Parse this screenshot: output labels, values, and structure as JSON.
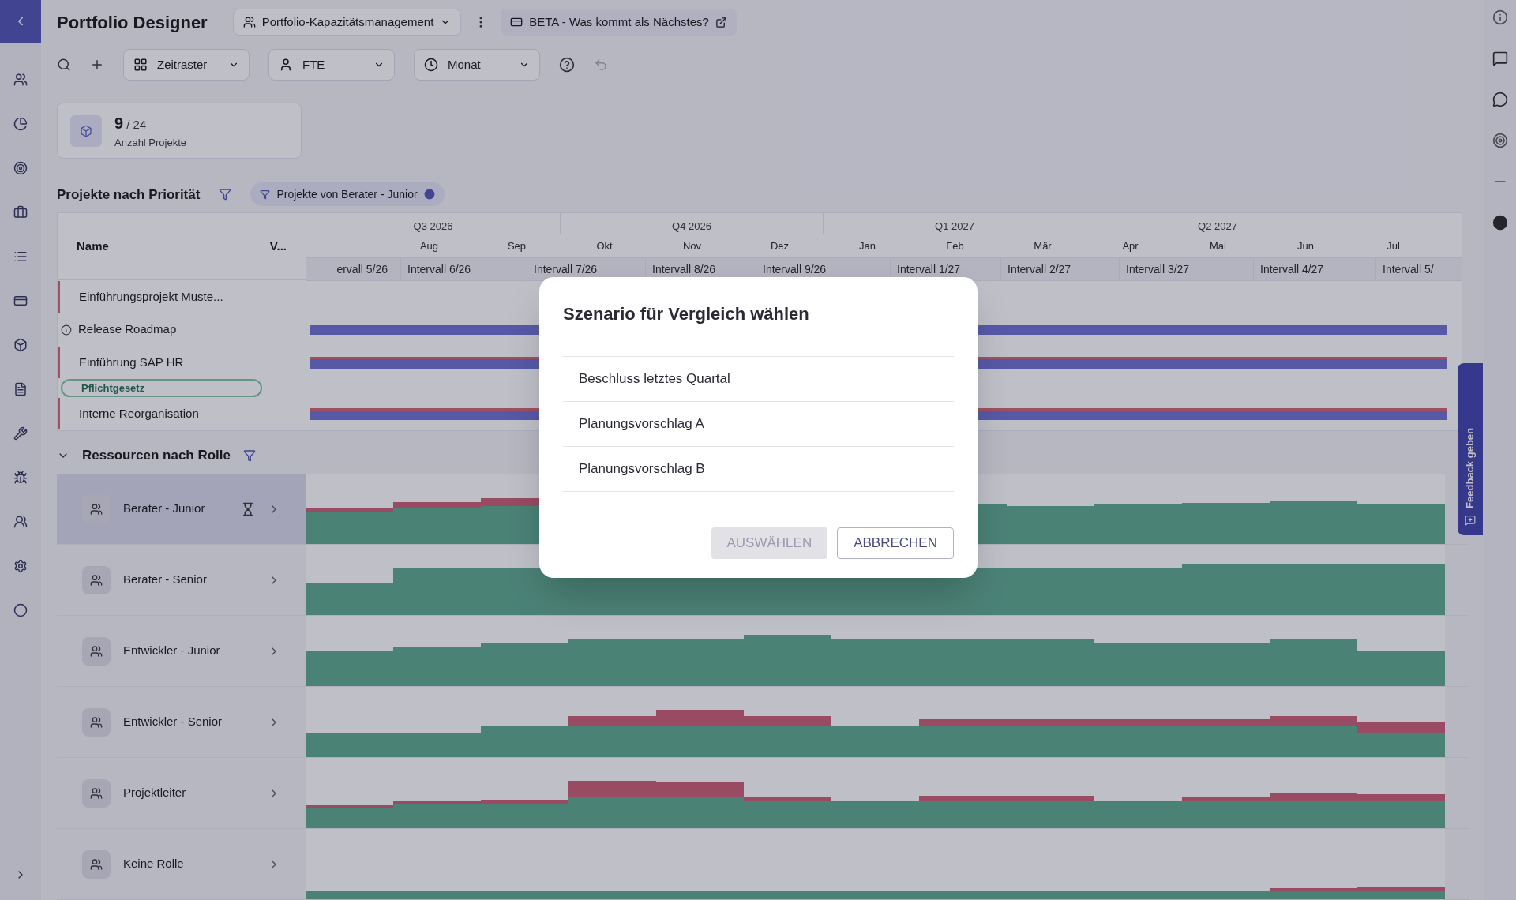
{
  "header": {
    "title": "Portfolio Designer",
    "portfolio": "Portfolio-Kapazitätsmanagement",
    "beta": "BETA - Was kommt als Nächstes?"
  },
  "toolbar": {
    "selects": [
      "Zeitraster",
      "FTE",
      "Monat"
    ]
  },
  "kpi": {
    "value": "9",
    "total": "/ 24",
    "label": "Anzahl Projekte"
  },
  "projects": {
    "title": "Projekte nach Priorität",
    "filter_chip": "Projekte von Berater - Junior",
    "columns": [
      "Name",
      "V..."
    ],
    "quarters": [
      "Q3 2026",
      "Q4 2026",
      "Q1 2027",
      "Q2 2027"
    ],
    "months": [
      "Aug",
      "Sep",
      "Okt",
      "Nov",
      "Dez",
      "Jan",
      "Feb",
      "Mär",
      "Apr",
      "Mai",
      "Jun",
      "Jul"
    ],
    "intervals": [
      "ervall 5/26",
      "Intervall 6/26",
      "Intervall 7/26",
      "Intervall 8/26",
      "Intervall 9/26",
      "Intervall 1/27",
      "Intervall 2/27",
      "Intervall 3/27",
      "Intervall 4/27",
      "Intervall 5/"
    ],
    "rows": [
      {
        "kind": "project",
        "name": "Einführungsprojekt Muste...",
        "flagged": true,
        "bar": false,
        "overline": false
      },
      {
        "kind": "project",
        "name": "Release Roadmap",
        "flagged": false,
        "bar": true,
        "overline": false
      },
      {
        "kind": "project",
        "name": "Einführung SAP HR",
        "flagged": true,
        "bar": true,
        "overline": true
      },
      {
        "kind": "tag",
        "name": "Pflichtgesetz"
      },
      {
        "kind": "project",
        "name": "Interne Reorganisation",
        "flagged": true,
        "bar": true,
        "overline": true
      }
    ]
  },
  "resources": {
    "title": "Ressourcen nach Rolle",
    "expanded": true,
    "roles": [
      {
        "name": "Berater - Junior",
        "selected": true
      },
      {
        "name": "Berater - Senior",
        "selected": false
      },
      {
        "name": "Entwickler - Junior",
        "selected": false
      },
      {
        "name": "Entwickler - Senior",
        "selected": false
      },
      {
        "name": "Projektleiter",
        "selected": false
      },
      {
        "name": "Keine Rolle",
        "selected": false
      }
    ]
  },
  "feedback": "Feedback geben",
  "dialog": {
    "title": "Szenario für Vergleich wählen",
    "options": [
      "Beschluss letztes Quartal",
      "Planungsvorschlag A",
      "Planungsvorschlag B"
    ],
    "buttons": [
      {
        "label": "AUSWÄHLEN",
        "disabled": true
      },
      {
        "label": "ABBRECHEN",
        "disabled": false
      }
    ]
  }
}
